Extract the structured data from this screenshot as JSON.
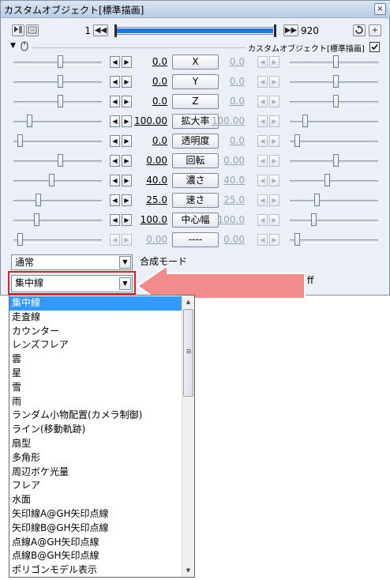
{
  "window": {
    "title": "カスタムオブジェクト[標準描画]",
    "close_glyph": "×"
  },
  "toolbar": {
    "frame_current": "1",
    "frame_end": "920",
    "prev_glyph": "◀◀",
    "next_glyph": "▶▶",
    "object_label": "カスタムオブジェクト[標準描画]",
    "checkbox_checked": true,
    "add_glyph": "+"
  },
  "params": [
    {
      "name": "X",
      "left_value": "0.0",
      "right_value": "0.0",
      "enabled": true,
      "right_enabled": false
    },
    {
      "name": "Y",
      "left_value": "0.0",
      "right_value": "0.0",
      "enabled": true,
      "right_enabled": false
    },
    {
      "name": "Z",
      "left_value": "0.0",
      "right_value": "0.0",
      "enabled": true,
      "right_enabled": false
    },
    {
      "name": "拡大率",
      "left_value": "100.00",
      "right_value": "100.00",
      "enabled": true,
      "right_enabled": false
    },
    {
      "name": "透明度",
      "left_value": "0.0",
      "right_value": "0.0",
      "enabled": true,
      "right_enabled": false
    },
    {
      "name": "回転",
      "left_value": "0.00",
      "right_value": "0.00",
      "enabled": true,
      "right_enabled": false
    },
    {
      "name": "濃さ",
      "left_value": "40.0",
      "right_value": "40.0",
      "enabled": true,
      "right_enabled": false
    },
    {
      "name": "速さ",
      "left_value": "25.0",
      "right_value": "25.0",
      "enabled": true,
      "right_enabled": false
    },
    {
      "name": "中心幅",
      "left_value": "100.0",
      "right_value": "100.0",
      "enabled": true,
      "right_enabled": false
    },
    {
      "name": "----",
      "left_value": "0.00",
      "right_value": "0.00",
      "enabled": false,
      "right_enabled": false
    }
  ],
  "blend": {
    "value": "通常",
    "label": "合成モード"
  },
  "effect": {
    "value": "集中線",
    "partial_label": "ff"
  },
  "dropdown": {
    "options": [
      "集中線",
      "走査線",
      "カウンター",
      "レンズフレア",
      "雲",
      "星",
      "雪",
      "雨",
      "ランダム小物配置(カメラ制御)",
      "ライン(移動軌跡)",
      "扇型",
      "多角形",
      "周辺ボケ光量",
      "フレア",
      "水面",
      "矢印線A@GH矢印点線",
      "矢印線B@GH矢印点線",
      "点線A@GH矢印点線",
      "点線B@GH矢印点線",
      "ポリゴンモデル表示"
    ],
    "selected_index": 0
  },
  "annotation": {
    "highlight_color": "#e02020",
    "arrow_color": "#f28b8b"
  }
}
